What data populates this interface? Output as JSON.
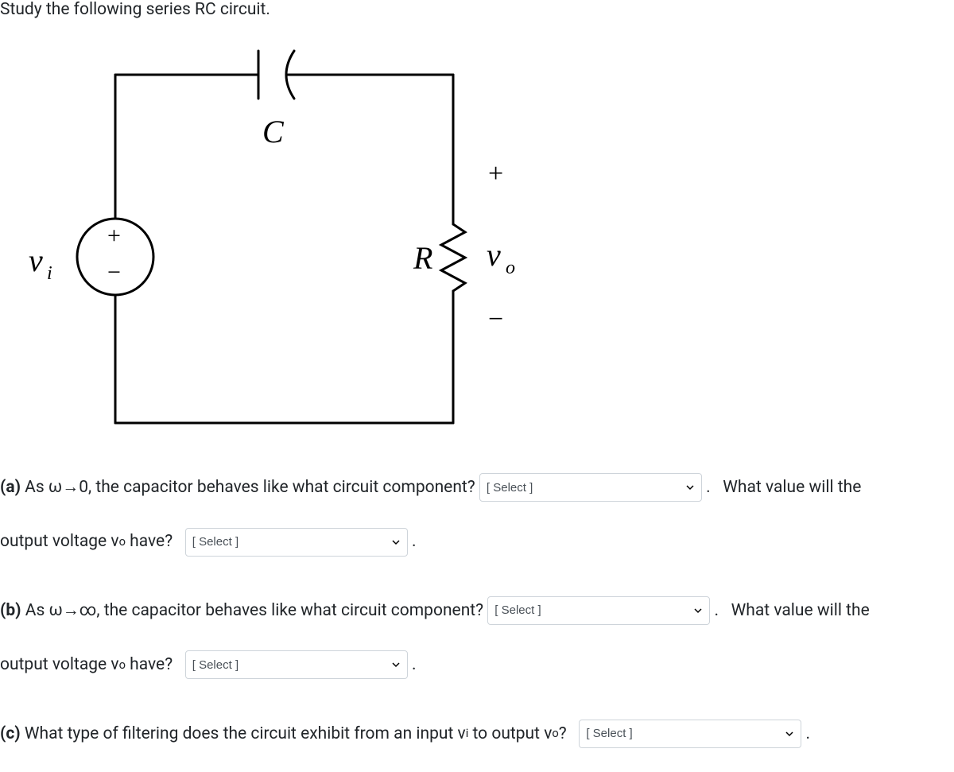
{
  "title": "Study the following series RC circuit.",
  "circuit": {
    "c_label": "C",
    "r_label": "R",
    "vi_label": "v",
    "vi_sub": "i",
    "vo_label": "v",
    "vo_sub": "o",
    "plus": "+",
    "minus": "−"
  },
  "qa": {
    "labels": {
      "a": "(a)",
      "b": "(b)",
      "c": "(c)"
    },
    "a_text1": " As ω→0, the capacitor behaves like what circuit component? ",
    "a_text2": " .   What value will the",
    "a_text3": "output voltage v",
    "a_sub": "o",
    "a_text4": " have?   ",
    "a_text5": " .",
    "b_text1": " As ω→∞, the capacitor behaves like what circuit component? ",
    "b_text2": " .   What value will the",
    "b_text3": "output voltage v",
    "b_sub": "o",
    "b_text4": " have?   ",
    "b_text5": " .",
    "c_text1": " What type of filtering does the circuit exhibit from an input v",
    "c_sub_i": "i",
    "c_text2": " to output v",
    "c_sub_o": "o",
    "c_text3": "?   ",
    "c_text4": " .",
    "select_placeholder": "[ Select ]"
  }
}
